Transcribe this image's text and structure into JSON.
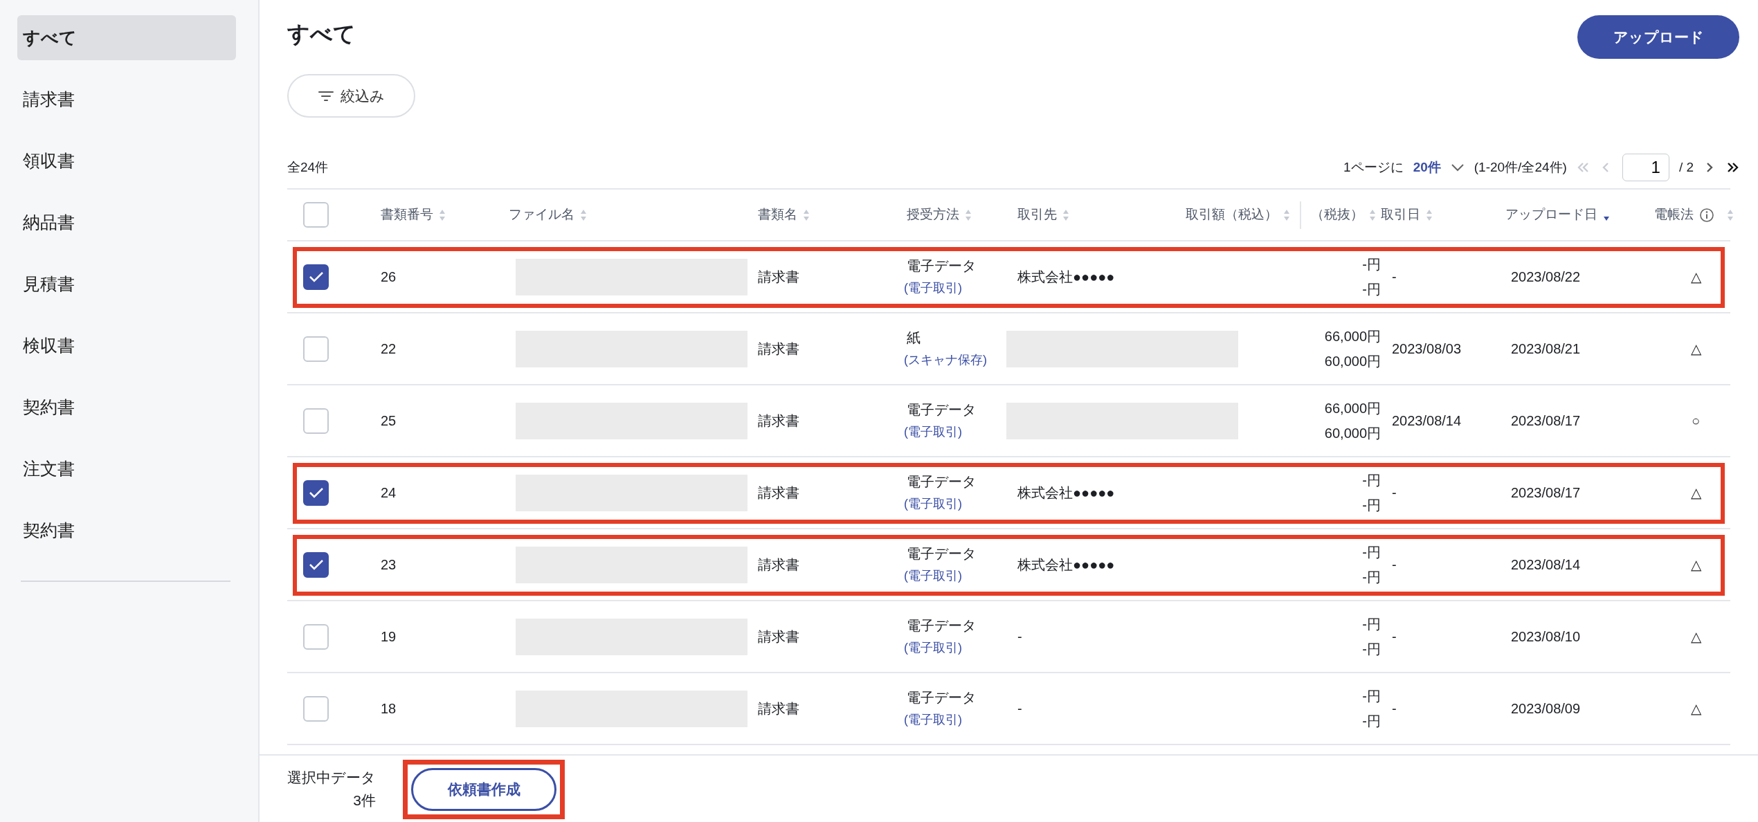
{
  "sidebar": {
    "items": [
      {
        "label": "すべて",
        "selected": true
      },
      {
        "label": "請求書",
        "selected": false
      },
      {
        "label": "領収書",
        "selected": false
      },
      {
        "label": "納品書",
        "selected": false
      },
      {
        "label": "見積書",
        "selected": false
      },
      {
        "label": "検収書",
        "selected": false
      },
      {
        "label": "契約書",
        "selected": false
      },
      {
        "label": "注文書",
        "selected": false
      },
      {
        "label": "契約書",
        "selected": false
      }
    ]
  },
  "page_title": "すべて",
  "upload_button": "アップロード",
  "filter_button": "絞込み",
  "total_count": "全24件",
  "pagination": {
    "per_page_label": "1ページに",
    "per_page_value": "20件",
    "range": "(1-20件/全24件)",
    "current_page": "1",
    "total_pages": "/ 2",
    "nav": [
      {
        "kind": "first",
        "disabled": true
      },
      {
        "kind": "prev",
        "disabled": true
      }
    ],
    "nav_after": [
      {
        "kind": "next",
        "disabled": false
      },
      {
        "kind": "last",
        "disabled": false
      }
    ]
  },
  "table": {
    "select_all_checked": false,
    "columns": [
      {
        "label": "書類番号",
        "sorted_descending": false,
        "info": false
      },
      {
        "label": "ファイル名",
        "sorted_descending": false,
        "info": false
      },
      {
        "label": "書類名",
        "sorted_descending": false,
        "info": false
      },
      {
        "label": "授受方法",
        "sorted_descending": false,
        "info": false
      },
      {
        "label": "取引先",
        "sorted_descending": false,
        "info": false
      },
      {
        "label": "取引額（税込）",
        "sorted_descending": false,
        "info": false
      },
      {
        "label": "（税抜）",
        "sorted_descending": false,
        "info": false
      },
      {
        "label": "取引日",
        "sorted_descending": false,
        "info": false
      },
      {
        "label": "アップロード日",
        "sorted_descending": true,
        "info": false
      },
      {
        "label": "電帳法",
        "sorted_descending": false,
        "info": true
      }
    ],
    "rows": [
      {
        "checked": true,
        "highlighted": true,
        "number": "26",
        "document": "請求書",
        "method": "電子データ",
        "method_detail": "(電子取引)",
        "partner": "株式会社●●●●●",
        "amount_incl": "-円",
        "amount_excl": "-円",
        "trade_date": "-",
        "upload_date": "2023/08/22",
        "law": "△"
      },
      {
        "checked": false,
        "highlighted": false,
        "number": "22",
        "document": "請求書",
        "method": "紙",
        "method_detail": "(スキャナ保存)",
        "amount_incl": "66,000円",
        "amount_excl": "60,000円",
        "trade_date": "2023/08/03",
        "upload_date": "2023/08/21",
        "law": "△"
      },
      {
        "checked": false,
        "highlighted": false,
        "number": "25",
        "document": "請求書",
        "method": "電子データ",
        "method_detail": "(電子取引)",
        "amount_incl": "66,000円",
        "amount_excl": "60,000円",
        "trade_date": "2023/08/14",
        "upload_date": "2023/08/17",
        "law": "○"
      },
      {
        "checked": true,
        "highlighted": true,
        "number": "24",
        "document": "請求書",
        "method": "電子データ",
        "method_detail": "(電子取引)",
        "partner": "株式会社●●●●●",
        "amount_incl": "-円",
        "amount_excl": "-円",
        "trade_date": "-",
        "upload_date": "2023/08/17",
        "law": "△"
      },
      {
        "checked": true,
        "highlighted": true,
        "number": "23",
        "document": "請求書",
        "method": "電子データ",
        "method_detail": "(電子取引)",
        "partner": "株式会社●●●●●",
        "amount_incl": "-円",
        "amount_excl": "-円",
        "trade_date": "-",
        "upload_date": "2023/08/14",
        "law": "△"
      },
      {
        "checked": false,
        "highlighted": false,
        "number": "19",
        "document": "請求書",
        "method": "電子データ",
        "method_detail": "(電子取引)",
        "partner": "-",
        "amount_incl": "-円",
        "amount_excl": "-円",
        "trade_date": "-",
        "upload_date": "2023/08/10",
        "law": "△"
      },
      {
        "checked": false,
        "highlighted": false,
        "number": "18",
        "document": "請求書",
        "method": "電子データ",
        "method_detail": "(電子取引)",
        "partner": "-",
        "amount_incl": "-円",
        "amount_excl": "-円",
        "trade_date": "-",
        "upload_date": "2023/08/09",
        "law": "△"
      }
    ]
  },
  "footer": {
    "selected_label": "選択中データ",
    "selected_count": "3件",
    "request_button": "依頼書作成",
    "request_highlighted": true
  }
}
